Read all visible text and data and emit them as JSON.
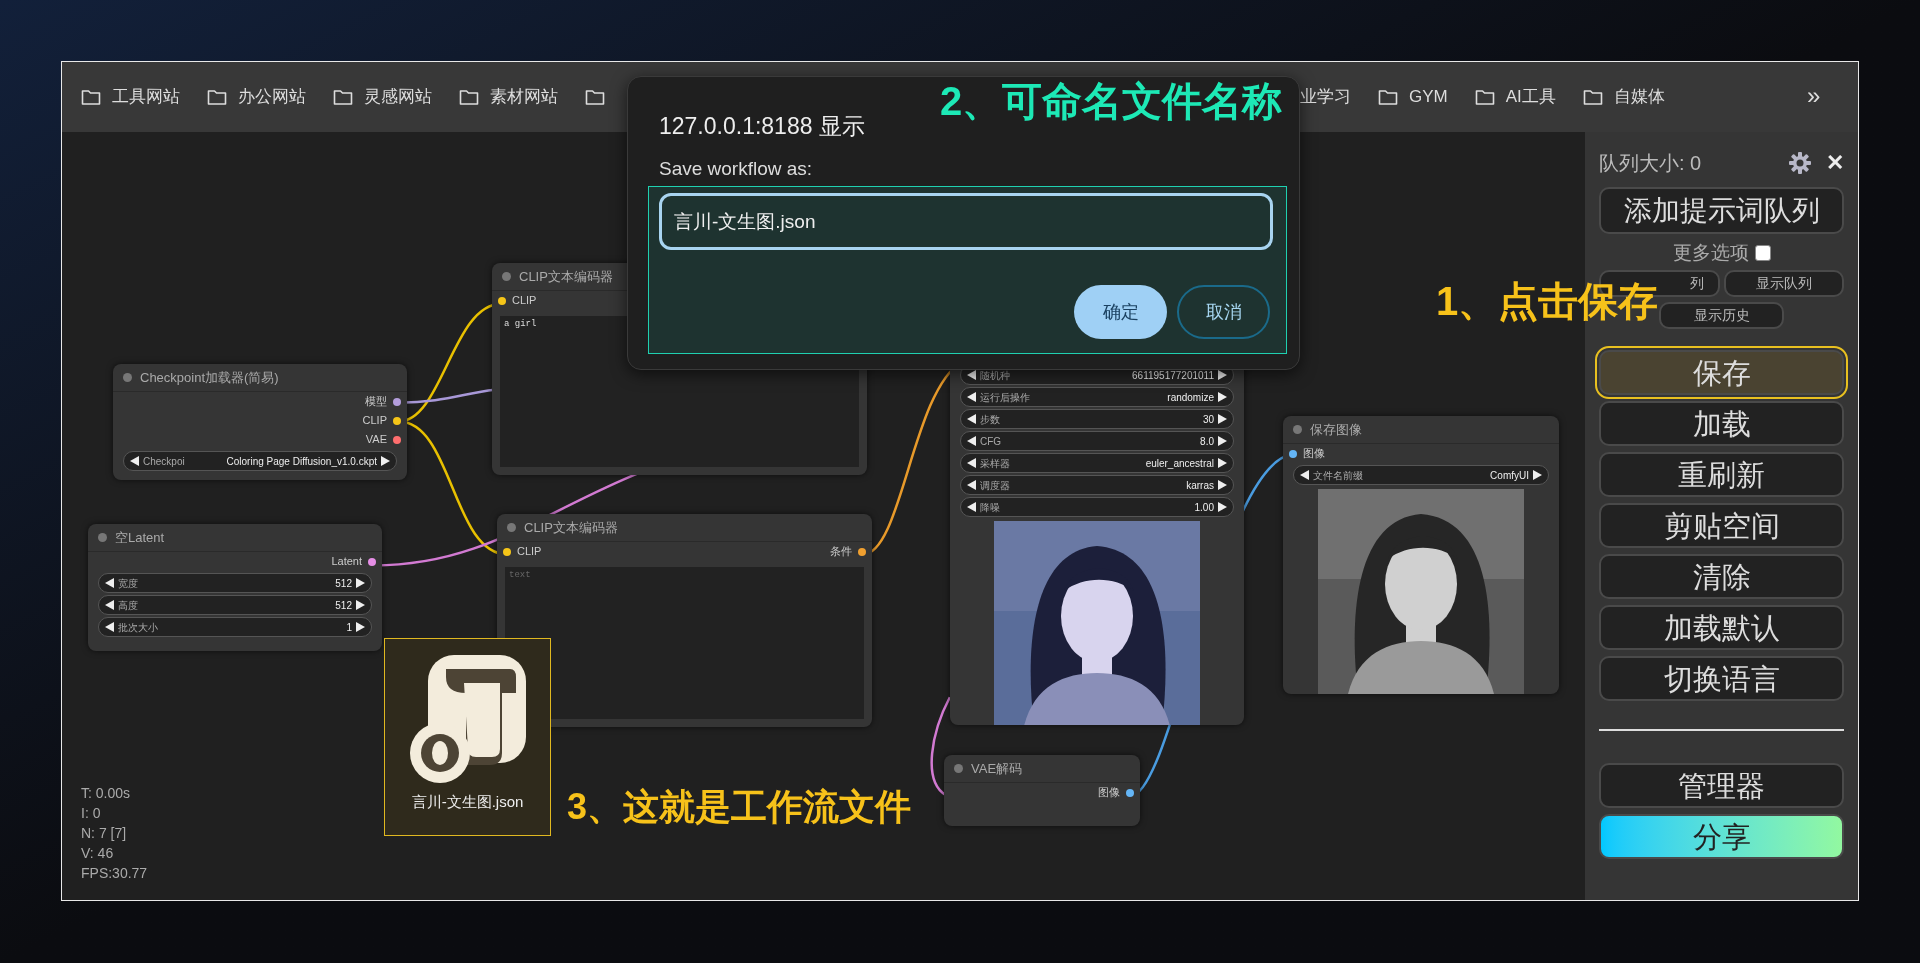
{
  "bookmarks": [
    {
      "label": "工具网站",
      "icon": true
    },
    {
      "label": "办公网站",
      "icon": true
    },
    {
      "label": "灵感网站",
      "icon": true
    },
    {
      "label": "素材网站",
      "icon": true
    },
    {
      "icon": true
    }
  ],
  "bookmarks_right": [
    {
      "label": "业学习",
      "icon": false
    },
    {
      "label": "GYM",
      "icon": true
    },
    {
      "label": "AI工具",
      "icon": true
    },
    {
      "label": "自媒体",
      "icon": true
    }
  ],
  "more_button": "»",
  "nodes": [
    {
      "title": "Checkpoint加载器(简易)",
      "outputs": [
        {
          "label": "模型",
          "color": "#b39ddb"
        },
        {
          "label": "CLIP",
          "color": "#f5c518"
        },
        {
          "label": "VAE",
          "color": "#ff6e6e"
        }
      ],
      "widgets": [
        {
          "label": "Checkpoi",
          "value": "Coloring Page Diffusion_v1.0.ckpt"
        }
      ]
    },
    {
      "title": "CLIP文本编码器",
      "inputs": [
        {
          "label": "CLIP",
          "color": "#f5c518"
        }
      ],
      "textarea": {
        "value": "a girl"
      }
    },
    {
      "widgets": [
        {
          "label": "随机种",
          "value": "661195177201011"
        },
        {
          "label": "运行后操作",
          "value": "randomize"
        },
        {
          "label": "步数",
          "value": "30"
        },
        {
          "label": "CFG",
          "value": "8.0"
        },
        {
          "label": "采样器",
          "value": "euler_ancestral"
        },
        {
          "label": "调度器",
          "value": "karras"
        },
        {
          "label": "降噪",
          "value": "1.00"
        }
      ],
      "image": {
        "kind": "picture"
      }
    },
    {
      "title": "保存图像",
      "inputs": [
        {
          "label": "图像",
          "color": "#64b5f6"
        }
      ],
      "widgets": [
        {
          "label": "文件名前缀",
          "value": "ComfyUI"
        }
      ],
      "image": {
        "kind": "picture"
      }
    },
    {
      "title": "空Latent",
      "outputs": [
        {
          "label": "Latent",
          "color": "#e58ee5"
        }
      ],
      "widgets": [
        {
          "label": "宽度",
          "value": "512"
        },
        {
          "label": "高度",
          "value": "512"
        },
        {
          "label": "批次大小",
          "value": "1"
        }
      ]
    },
    {
      "title": "CLIP文本编码器",
      "inputs": [
        {
          "label": "CLIP",
          "color": "#f5c518"
        }
      ],
      "outputs": [
        {
          "label": "条件",
          "color": "#f0a030"
        }
      ],
      "textarea": {
        "placeholder": "text"
      }
    },
    {
      "title": "VAE解码",
      "outputs": [
        {
          "label": "图像",
          "color": "#64b5f6"
        }
      ]
    }
  ],
  "stats": [
    "T: 0.00s",
    "I: 0",
    "N: 7 [7]",
    "V: 46",
    "FPS:30.77"
  ],
  "file_item": {
    "label": "言川-文生图.json"
  },
  "sidebar": {
    "queue_size": "队列大小: 0",
    "close": "✕",
    "queue_button": "添加提示词队列",
    "more_options": {
      "label": "更多选项",
      "checked": false
    },
    "small_buttons": [
      "列",
      "显示队列",
      "显示历史"
    ],
    "buttons": [
      {
        "label": "保存",
        "highlighted": true
      },
      {
        "label": "加载",
        "highlighted": false
      },
      {
        "label": "重刷新",
        "highlighted": false
      },
      {
        "label": "剪贴空间",
        "highlighted": false
      },
      {
        "label": "清除",
        "highlighted": false
      },
      {
        "label": "加载默认",
        "highlighted": false
      },
      {
        "label": "切换语言",
        "highlighted": false
      }
    ],
    "bottom_buttons": [
      {
        "label": "管理器",
        "kind": "plain"
      },
      {
        "label": "分享",
        "kind": "gradient"
      }
    ]
  },
  "dialog": {
    "title": "127.0.0.1:8188 显示",
    "prompt": "Save workflow as:",
    "value": "言川-文生图.json",
    "buttons": [
      {
        "label": "确定",
        "kind": "primary"
      },
      {
        "label": "取消",
        "kind": "secondary"
      }
    ]
  },
  "annotations": [
    {
      "text": "2、可命名文件名称",
      "color": "#1de9b6"
    },
    {
      "text": "1、点击保存",
      "color": "#f7c21a"
    },
    {
      "text": "3、这就是工作流文件",
      "color": "#f7c21a"
    }
  ]
}
